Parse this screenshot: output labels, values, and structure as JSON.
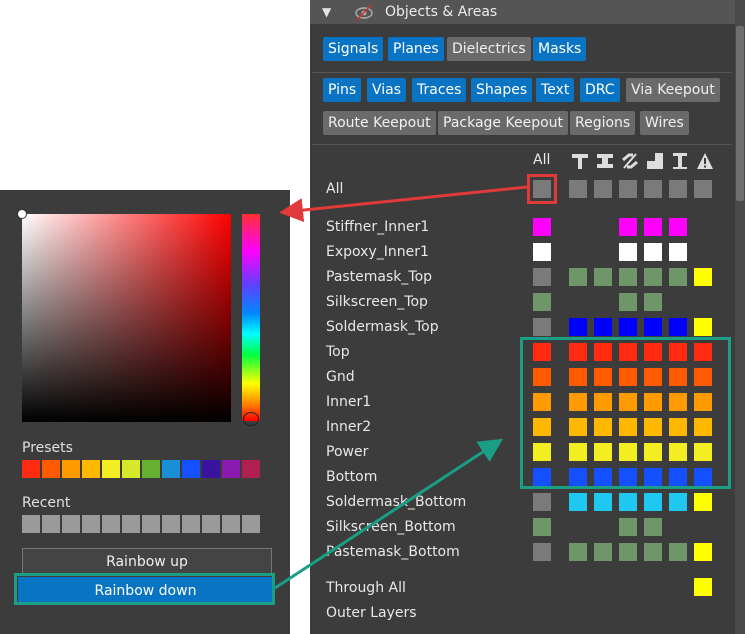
{
  "objects_panel": {
    "title": "Objects & Areas",
    "group_buttons": [
      "Signals",
      "Planes",
      "Dielectrics",
      "Masks"
    ],
    "type_buttons_row1": [
      "Pins",
      "Vias",
      "Traces",
      "Shapes",
      "Text",
      "DRC",
      "Via Keepout"
    ],
    "type_buttons_row2": [
      "Route Keepout",
      "Package Keepout",
      "Regions",
      "Wires"
    ],
    "all_column_label": "All",
    "column_icons": [
      "pin-icon",
      "via-icon",
      "trace-icon",
      "shape-icon",
      "text-icon",
      "drc-icon"
    ],
    "rows": [
      {
        "name": "All",
        "colors": [
          "#7a7a7a",
          "#7a7a7a",
          "#7a7a7a",
          "#7a7a7a",
          "#7a7a7a",
          "#7a7a7a",
          "#7a7a7a"
        ]
      },
      {
        "name": "Stiffner_Inner1",
        "colors": [
          "#ff00ff",
          null,
          null,
          "#ff00ff",
          "#ff00ff",
          "#ff00ff",
          null
        ]
      },
      {
        "name": "Expoxy_Inner1",
        "colors": [
          "#ffffff",
          null,
          null,
          "#ffffff",
          "#ffffff",
          "#ffffff",
          null
        ]
      },
      {
        "name": "Pastemask_Top",
        "colors": [
          "#7a7a7a",
          "#6e9668",
          "#6e9668",
          "#6e9668",
          "#6e9668",
          "#6e9668",
          "#ffff00"
        ]
      },
      {
        "name": "Silkscreen_Top",
        "colors": [
          "#6e9668",
          null,
          null,
          "#6e9668",
          "#6e9668",
          null,
          null
        ]
      },
      {
        "name": "Soldermask_Top",
        "colors": [
          "#7a7a7a",
          "#0000ff",
          "#0000ff",
          "#0000ff",
          "#0000ff",
          "#0000ff",
          "#ffff00"
        ]
      },
      {
        "name": "Top",
        "colors": [
          "#ff2a10",
          "#ff2a10",
          "#ff2a10",
          "#ff2a10",
          "#ff2a10",
          "#ff2a10",
          "#ff2a10"
        ]
      },
      {
        "name": "Gnd",
        "colors": [
          "#ff5a00",
          "#ff5a00",
          "#ff5a00",
          "#ff5a00",
          "#ff5a00",
          "#ff5a00",
          "#ff5a00"
        ]
      },
      {
        "name": "Inner1",
        "colors": [
          "#ff9a00",
          "#ff9a00",
          "#ff9a00",
          "#ff9a00",
          "#ff9a00",
          "#ff9a00",
          "#ff9a00"
        ]
      },
      {
        "name": "Inner2",
        "colors": [
          "#ffb800",
          "#ffb800",
          "#ffb800",
          "#ffb800",
          "#ffb800",
          "#ffb800",
          "#ffb800"
        ]
      },
      {
        "name": "Power",
        "colors": [
          "#f2ee22",
          "#f2ee22",
          "#f2ee22",
          "#f2ee22",
          "#f2ee22",
          "#f2ee22",
          "#f2ee22"
        ]
      },
      {
        "name": "Bottom",
        "colors": [
          "#1450ff",
          "#1450ff",
          "#1450ff",
          "#1450ff",
          "#1450ff",
          "#1450ff",
          "#1450ff"
        ]
      },
      {
        "name": "Soldermask_Bottom",
        "colors": [
          "#7a7a7a",
          "#1ec8f0",
          "#1ec8f0",
          "#1ec8f0",
          "#1ec8f0",
          "#1ec8f0",
          "#ffff00"
        ]
      },
      {
        "name": "Silkscreen_Bottom",
        "colors": [
          "#6e9668",
          null,
          null,
          "#6e9668",
          "#6e9668",
          null,
          null
        ]
      },
      {
        "name": "Pastemask_Bottom",
        "colors": [
          "#7a7a7a",
          "#6e9668",
          "#6e9668",
          "#6e9668",
          "#6e9668",
          "#6e9668",
          "#ffff00"
        ]
      }
    ],
    "through_all": {
      "name": "Through All",
      "color": "#ffff00"
    },
    "outer_layers": {
      "name": "Outer Layers"
    }
  },
  "color_picker": {
    "presets_label": "Presets",
    "presets": [
      "#ff2a10",
      "#ff5a00",
      "#ff9a00",
      "#ffb800",
      "#f2ee22",
      "#d6e82a",
      "#66b032",
      "#1a8fd6",
      "#1450ff",
      "#3a12a0",
      "#8a1ab0",
      "#b0204e"
    ],
    "recent_label": "Recent",
    "recent_count": 12,
    "recent_color": "#9a9a9a",
    "rainbow_up_label": "Rainbow up",
    "rainbow_down_label": "Rainbow down"
  },
  "accent_colors": {
    "selected_button": "#0a74c4",
    "annotation_red": "#e03a3a",
    "annotation_green": "#1a9e85"
  }
}
